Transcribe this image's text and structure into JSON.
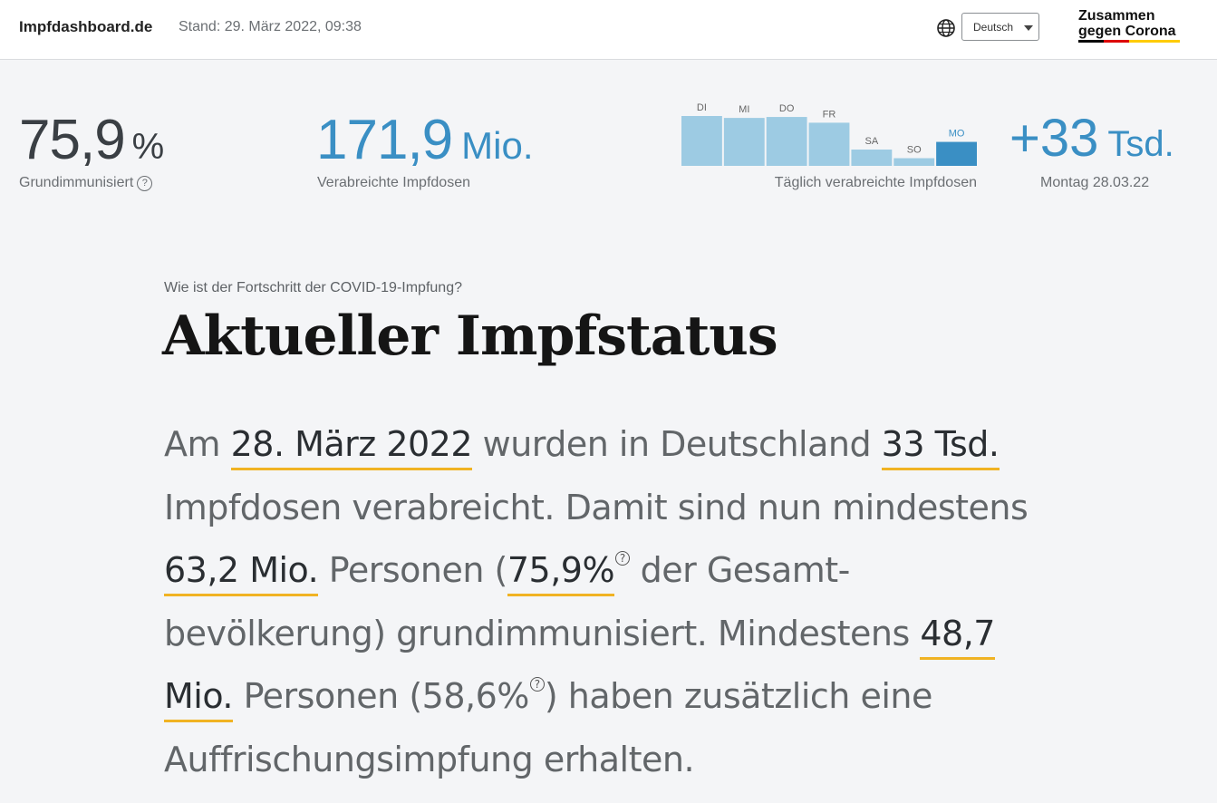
{
  "header": {
    "site_name": "Impfdashboard.de",
    "stand": "Stand: 29. März 2022, 09:38",
    "language": "Deutsch",
    "logo_line1": "Zusammen",
    "logo_line2": "gegen Corona"
  },
  "stats": {
    "grundimmunisiert_value": "75,9",
    "grundimmunisiert_unit": "%",
    "grundimmunisiert_label": "Grundimmunisiert",
    "impfdosen_value": "171,9",
    "impfdosen_unit": "Mio.",
    "impfdosen_label": "Verabreichte Impfdosen",
    "taeglich_label": "Täglich verabreichte Impfdosen",
    "latest_value": "+33",
    "latest_unit": "Tsd.",
    "latest_label": "Montag 28.03.22"
  },
  "chart_data": {
    "type": "bar",
    "categories": [
      "DI",
      "MI",
      "DO",
      "FR",
      "SA",
      "SO",
      "MO"
    ],
    "values": [
      52,
      50,
      51,
      45,
      17,
      8,
      25
    ],
    "highlight_index": 6,
    "colors": {
      "bar": "#9dcbe3",
      "highlight": "#3a8fc4",
      "label": "#666",
      "highlight_label": "#3a8fc4"
    }
  },
  "main": {
    "question": "Wie ist der Fortschritt der COVID-19-Impfung?",
    "title": "Aktueller Impfstatus",
    "p_am": "Am ",
    "p_date": "28. März 2022",
    "p_wurden": " wurden in Deutschland ",
    "p_doses": "33 Tsd.",
    "p_verabreicht": " Impfdosen verabreicht. Damit sind nun mindestens ",
    "p_persons1": "63,2 Mio.",
    "p_personen1": " Personen (",
    "p_pct1": "75,9%",
    "p_gesamt": " der Gesamt­bevölkerung) grundimmunisiert. Mindestens ",
    "p_persons2": "48,7 Mio.",
    "p_personen2": " Personen (58,6%",
    "p_rest": ") haben zusätzlich eine Auffrischungsimpfung erhalten."
  },
  "colors": {
    "accent_blue": "#3a8fc4",
    "highlight_yellow": "#f0b323",
    "flag_black": "#000000",
    "flag_red": "#dd0000",
    "flag_gold": "#ffcc00"
  }
}
